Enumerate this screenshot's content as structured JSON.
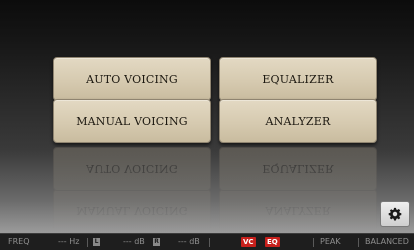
{
  "menu": {
    "auto_voicing": "AUTO VOICING",
    "equalizer": "EQUALIZER",
    "manual_voicing": "MANUAL VOICING",
    "analyzer": "ANALYZER"
  },
  "settings_icon": "gear-icon",
  "status_bar": {
    "freq_label": "FREQ",
    "freq_value": "--- Hz",
    "left_channel": "L",
    "left_value": "--- dB",
    "right_channel": "R",
    "right_value": "--- dB",
    "vc_badge": "VC",
    "eq_badge": "EQ",
    "peak_label": "PEAK",
    "mode_label": "BALANCED"
  },
  "colors": {
    "button_face": "#d6cab0",
    "badge_red": "#c8201c",
    "status_bg": "#1e1e1e"
  }
}
